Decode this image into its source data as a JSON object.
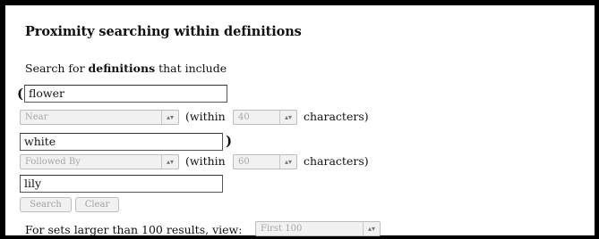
{
  "title": "Proximity searching within definitions",
  "intro": {
    "prefix": "Search for ",
    "bold": "definitions",
    "suffix": " that include"
  },
  "open_paren": "(",
  "close_paren": ")",
  "term1": {
    "value": "flower"
  },
  "op1": {
    "selected": "Near",
    "within_label": "(within",
    "distance": "40",
    "unit_label": "characters)"
  },
  "term2": {
    "value": "white"
  },
  "op2": {
    "selected": "Followed By",
    "within_label": "(within",
    "distance": "60",
    "unit_label": "characters)"
  },
  "term3": {
    "value": "lily"
  },
  "buttons": {
    "search": "Search",
    "clear": "Clear"
  },
  "footer": {
    "label": "For sets larger than 100 results, view:",
    "view_selected": "First 100"
  }
}
